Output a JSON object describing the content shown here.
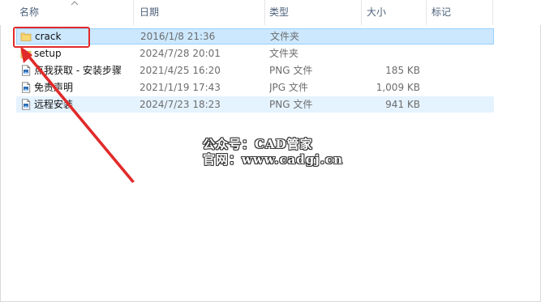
{
  "columns": {
    "name": "名称",
    "date": "日期",
    "type": "类型",
    "size": "大小",
    "tags": "标记"
  },
  "files": [
    {
      "name": "crack",
      "date": "2016/1/8 21:36",
      "type": "文件夹",
      "size": "",
      "icon": "folder-icon",
      "state": "selected"
    },
    {
      "name": "setup",
      "date": "2024/7/28 20:01",
      "type": "文件夹",
      "size": "",
      "icon": "folder-icon",
      "state": "normal"
    },
    {
      "name": "点我获取 - 安装步骤",
      "date": "2021/4/25 16:20",
      "type": "PNG 文件",
      "size": "185 KB",
      "icon": "image-file-icon",
      "state": "normal"
    },
    {
      "name": "免责声明",
      "date": "2021/1/19 17:43",
      "type": "JPG 文件",
      "size": "1,009 KB",
      "icon": "image-file-icon",
      "state": "normal"
    },
    {
      "name": "远程安装",
      "date": "2024/7/23 18:23",
      "type": "PNG 文件",
      "size": "941 KB",
      "icon": "image-file-icon",
      "state": "hovered"
    }
  ],
  "watermark": {
    "line1": "公众号：CAD管家",
    "line2": "官网：www.cadgj.cn"
  },
  "colors": {
    "selected_bg": "#cce8ff",
    "selected_border": "#99d1ff",
    "hover_bg": "#e5f3ff",
    "header_text": "#4c607a",
    "annotation_red": "#e12a2a",
    "folder_yellow": "#f8d775"
  }
}
